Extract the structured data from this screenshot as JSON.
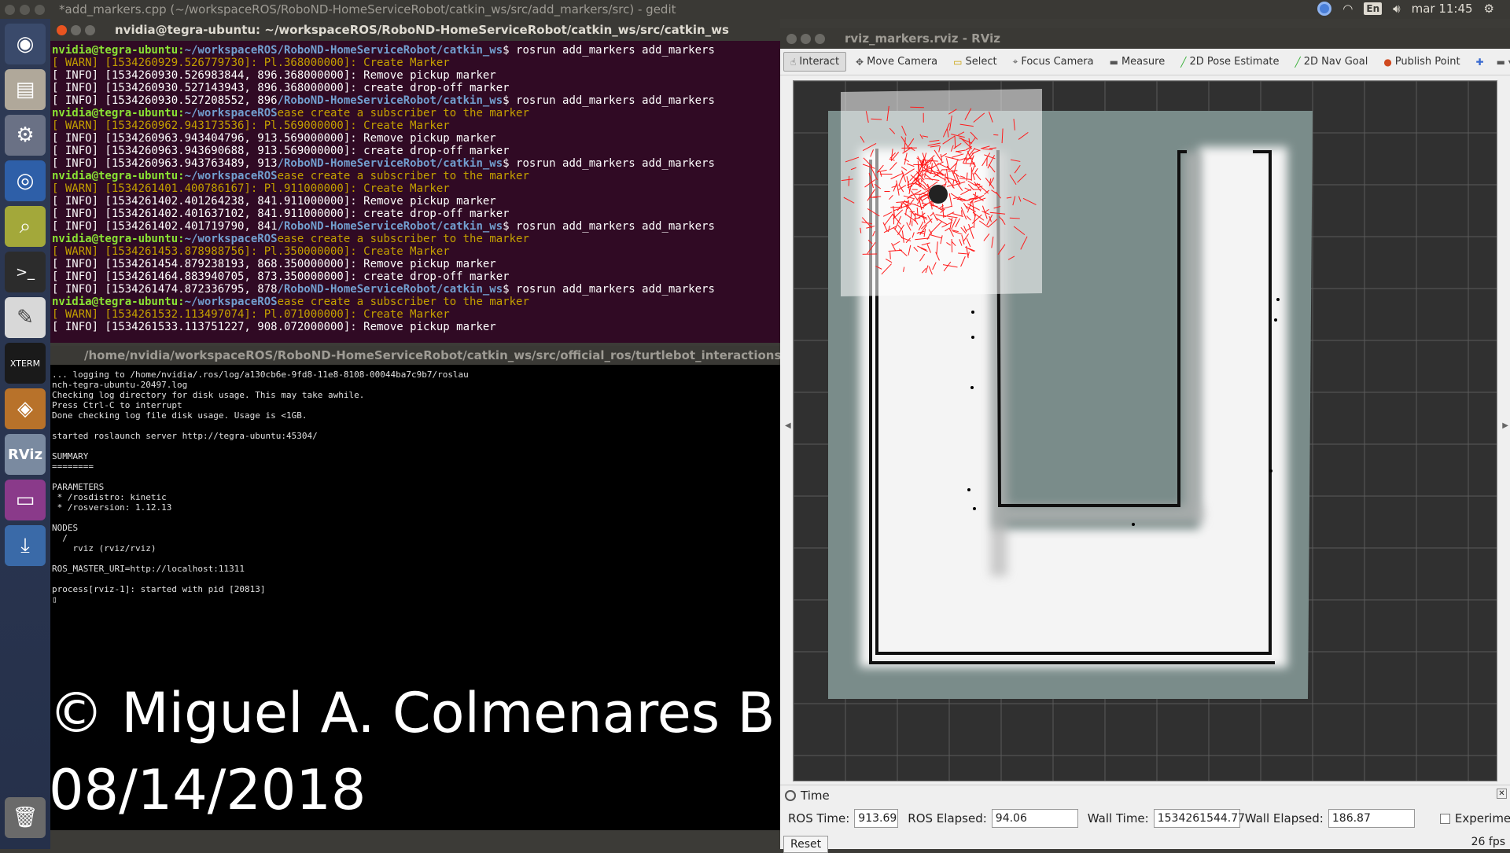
{
  "top_panel": {
    "title": "*add_markers.cpp (~/workspaceROS/RoboND-HomeServiceRobot/catkin_ws/src/add_markers/src) - gedit",
    "keyboard": "En",
    "clock": "mar 11:45"
  },
  "launcher": {
    "items": [
      "ubuntu-dash-icon",
      "files-icon",
      "settings-icon",
      "chromium-icon",
      "image-viewer-icon",
      "terminal-icon",
      "text-editor-icon",
      "xterm-icon",
      "virtualbox-icon",
      "rviz-icon",
      "app-icon",
      "install-icon",
      "trash-icon"
    ]
  },
  "term1": {
    "title": "nvidia@tegra-ubuntu: ~/workspaceROS/RoboND-HomeServiceRobot/catkin_ws/src/catkin_ws",
    "lines": [
      {
        "type": "prompt",
        "user": "nvidia@tegra-ubuntu:",
        "path": "~/workspaceROS/RoboND-HomeServiceRobot/catkin_ws",
        "cmd": "$ rosrun add_markers add_markers"
      },
      {
        "type": "warn",
        "text": "[ WARN] [1534260929.526779730]: Pl.368000000]: Create Marker"
      },
      {
        "type": "info",
        "text": "[ INFO] [1534260930.526983844, 896.368000000]: Remove pickup marker"
      },
      {
        "type": "info",
        "text": "[ INFO] [1534260930.527143943, 896.368000000]: create drop-off marker"
      },
      {
        "type": "mixed",
        "text": "[ INFO] [1534260930.527208552, 896",
        "path": "/RoboND-HomeServiceRobot/catkin_ws",
        "cmd": "$ rosrun add_markers add_markers"
      },
      {
        "type": "prompt2",
        "user": "nvidia@tegra-ubuntu:",
        "path": "~/workspaceROS",
        "cmd": "ease create a subscriber to the marker"
      },
      {
        "type": "warn",
        "text": "[ WARN] [1534260962.943173536]: Pl.569000000]: Create Marker"
      },
      {
        "type": "info",
        "text": "[ INFO] [1534260963.943404796, 913.569000000]: Remove pickup marker"
      },
      {
        "type": "info",
        "text": "[ INFO] [1534260963.943690688, 913.569000000]: create drop-off marker"
      },
      {
        "type": "mixed",
        "text": "[ INFO] [1534260963.943763489, 913",
        "path": "/RoboND-HomeServiceRobot/catkin_ws",
        "cmd": "$ rosrun add_markers add_markers"
      },
      {
        "type": "prompt2",
        "user": "nvidia@tegra-ubuntu:",
        "path": "~/workspaceROS",
        "cmd": "ease create a subscriber to the marker"
      },
      {
        "type": "warn",
        "text": "[ WARN] [1534261401.400786167]: Pl.911000000]: Create Marker"
      },
      {
        "type": "info",
        "text": "[ INFO] [1534261402.401264238, 841.911000000]: Remove pickup marker"
      },
      {
        "type": "info",
        "text": "[ INFO] [1534261402.401637102, 841.911000000]: create drop-off marker"
      },
      {
        "type": "mixed",
        "text": "[ INFO] [1534261402.401719790, 841",
        "path": "/RoboND-HomeServiceRobot/catkin_ws",
        "cmd": "$ rosrun add_markers add_markers"
      },
      {
        "type": "prompt2",
        "user": "nvidia@tegra-ubuntu:",
        "path": "~/workspaceROS",
        "cmd": "ease create a subscriber to the marker"
      },
      {
        "type": "warn",
        "text": "[ WARN] [1534261453.878988756]: Pl.350000000]: Create Marker"
      },
      {
        "type": "info",
        "text": "[ INFO] [1534261454.879238193, 868.350000000]: Remove pickup marker"
      },
      {
        "type": "info",
        "text": "[ INFO] [1534261464.883940705, 873.350000000]: create drop-off marker"
      },
      {
        "type": "mixed",
        "text": "[ INFO] [1534261474.872336795, 878",
        "path": "/RoboND-HomeServiceRobot/catkin_ws",
        "cmd": "$ rosrun add_markers add_markers"
      },
      {
        "type": "prompt2",
        "user": "nvidia@tegra-ubuntu:",
        "path": "~/workspaceROS",
        "cmd": "ease create a subscriber to the marker"
      },
      {
        "type": "warn",
        "text": "[ WARN] [1534261532.113497074]: Pl.071000000]: Create Marker"
      },
      {
        "type": "info",
        "text": "[ INFO] [1534261533.113751227, 908.072000000]: Remove pickup marker"
      }
    ]
  },
  "term2": {
    "title": "/home/nvidia/workspaceROS/RoboND-HomeServiceRobot/catkin_ws/src/official_ros/turtlebot_interactions/turtlebot",
    "lines": [
      "... logging to /home/nvidia/.ros/log/a130cb6e-9fd8-11e8-8108-00044ba7c9b7/roslau",
      "nch-tegra-ubuntu-20497.log",
      "Checking log directory for disk usage. This may take awhile.",
      "Press Ctrl-C to interrupt",
      "Done checking log file disk usage. Usage is <1GB.",
      "",
      "started roslaunch server http://tegra-ubuntu:45304/",
      "",
      "SUMMARY",
      "========",
      "",
      "PARAMETERS",
      " * /rosdistro: kinetic",
      " * /rosversion: 1.12.13",
      "",
      "NODES",
      "  /",
      "    rviz (rviz/rviz)",
      "",
      "ROS_MASTER_URI=http://localhost:11311",
      "",
      "process[rviz-1]: started with pid [20813]",
      "▯"
    ]
  },
  "watermark": {
    "line1": "© Miguel A. Colmenares B.",
    "line2": "08/14/2018"
  },
  "rviz": {
    "title": "rviz_markers.rviz - RViz",
    "tools": [
      {
        "label": "Interact",
        "icon": "hand-icon",
        "active": true
      },
      {
        "label": "Move Camera",
        "icon": "move-icon",
        "active": false
      },
      {
        "label": "Select",
        "icon": "select-icon",
        "active": false
      },
      {
        "label": "Focus Camera",
        "icon": "focus-icon",
        "active": false
      },
      {
        "label": "Measure",
        "icon": "measure-icon",
        "active": false
      },
      {
        "label": "2D Pose Estimate",
        "icon": "pose-arrow-icon",
        "active": false
      },
      {
        "label": "2D Nav Goal",
        "icon": "goal-arrow-icon",
        "active": false
      },
      {
        "label": "Publish Point",
        "icon": "pin-icon",
        "active": false
      }
    ],
    "time_panel": {
      "title": "Time",
      "ros_time_label": "ROS Time:",
      "ros_time": "913.69",
      "ros_elapsed_label": "ROS Elapsed:",
      "ros_elapsed": "94.06",
      "wall_time_label": "Wall Time:",
      "wall_time": "1534261544.77",
      "wall_elapsed_label": "Wall Elapsed:",
      "wall_elapsed": "186.87",
      "experimental_label": "Experimental",
      "reset_label": "Reset",
      "fps": "26 fps"
    }
  }
}
